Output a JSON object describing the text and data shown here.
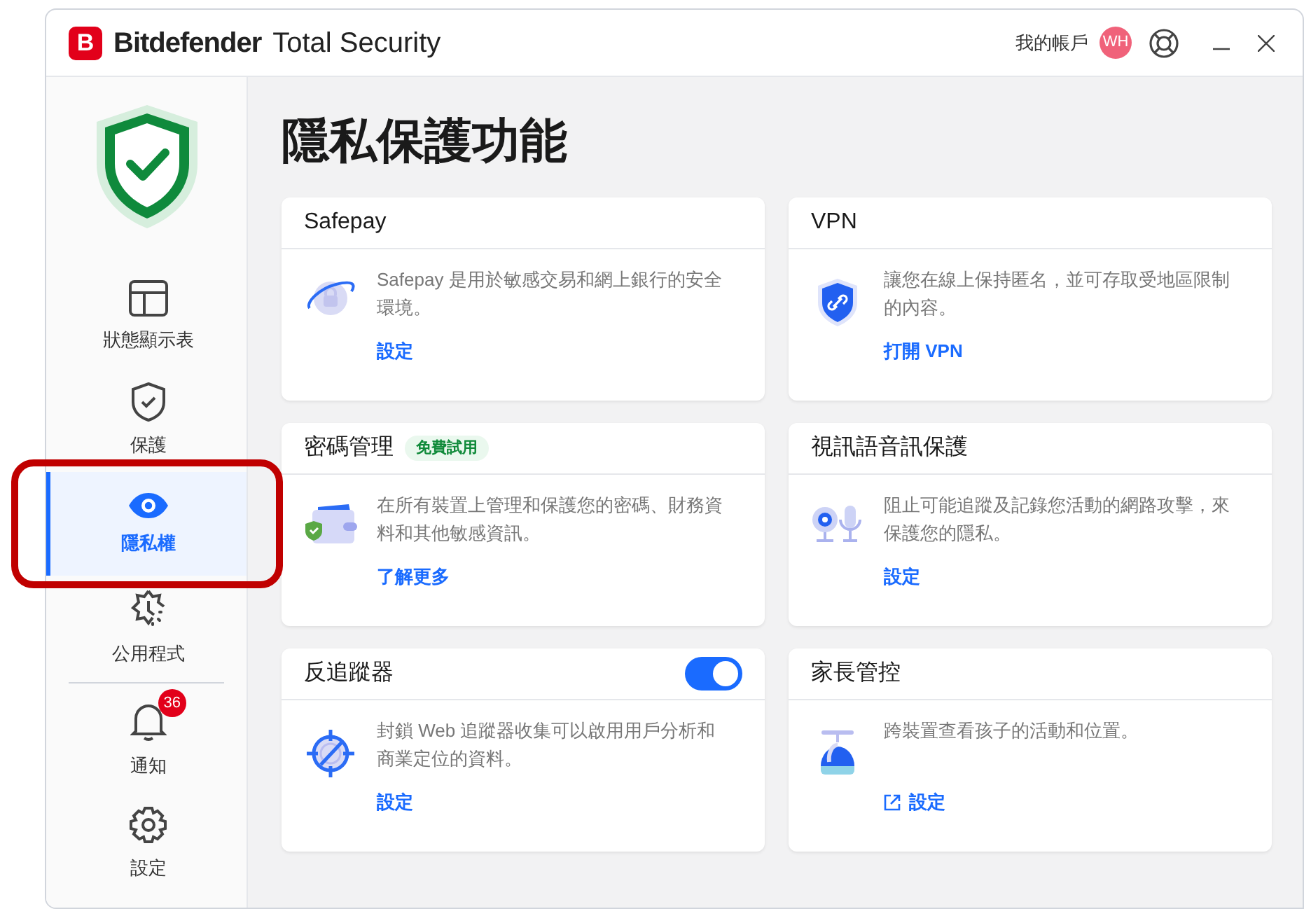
{
  "window": {
    "logo_letter": "B",
    "brand": "Bitdefender",
    "product": "Total Security",
    "account": "我的帳戶",
    "avatar": "WH"
  },
  "sidebar": {
    "items": [
      {
        "kind": "dashboard",
        "label": "狀態顯示表",
        "selected": false
      },
      {
        "kind": "protection",
        "label": "保護",
        "selected": false
      },
      {
        "kind": "privacy",
        "label": "隱私權",
        "selected": true
      },
      {
        "kind": "utilities",
        "label": "公用程式",
        "selected": false
      },
      {
        "kind": "notifications",
        "label": "通知",
        "selected": false,
        "badge": "36"
      },
      {
        "kind": "settings",
        "label": "設定",
        "selected": false
      }
    ]
  },
  "page_title": "隱私保護功能",
  "cards": [
    {
      "kind": "safepay",
      "title": "Safepay",
      "description": "Safepay 是用於敏感交易和網上銀行的安全環境。",
      "action": "設定",
      "external": false
    },
    {
      "kind": "vpn",
      "title": "VPN",
      "description": "讓您在線上保持匿名，並可存取受地區限制的內容。",
      "action": "打開 VPN",
      "external": false
    },
    {
      "kind": "password",
      "title": "密碼管理",
      "badge": "免費試用",
      "description": "在所有裝置上管理和保護您的密碼、財務資料和其他敏感資訊。",
      "action": "了解更多",
      "external": false
    },
    {
      "kind": "video",
      "title": "視訊語音訊保護",
      "description": "阻止可能追蹤及記錄您活動的網路攻擊，來保護您的隱私。",
      "action": "設定",
      "external": false
    },
    {
      "kind": "tracker",
      "title": "反追蹤器",
      "toggle": {
        "on": true
      },
      "description": "封鎖 Web 追蹤器收集可以啟用用戶分析和商業定位的資料。",
      "action": "設定",
      "external": false
    },
    {
      "kind": "parental",
      "title": "家長管控",
      "description": "跨裝置查看孩子的活動和位置。",
      "action": "設定",
      "external": true
    }
  ]
}
